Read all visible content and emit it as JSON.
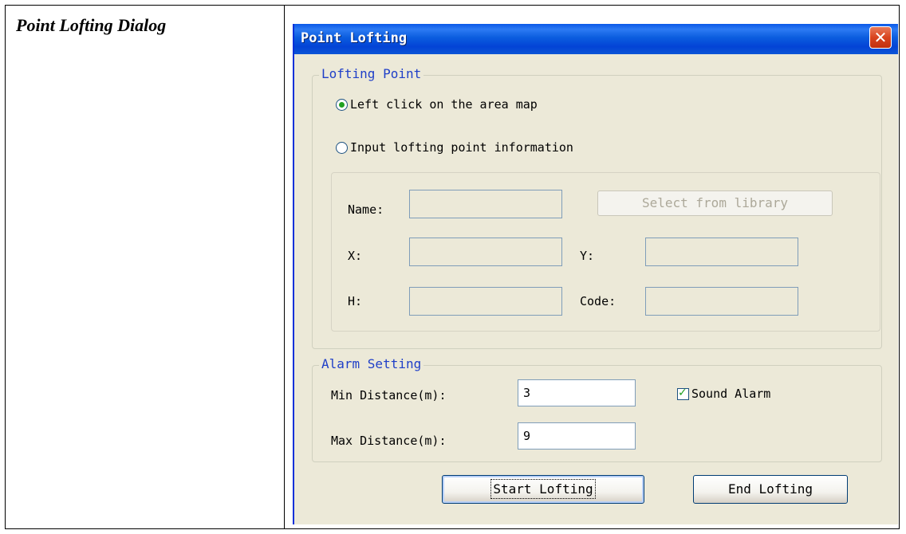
{
  "document": {
    "label": "Point Lofting Dialog"
  },
  "dialog": {
    "title": "Point Lofting",
    "close_symbol": "✕"
  },
  "lofting_point": {
    "group_title": "Lofting Point",
    "option_map": "Left click on the area map",
    "option_input": "Input lofting point information",
    "selected": "option_map",
    "name_label": "Name:",
    "x_label": "X:",
    "y_label": "Y:",
    "h_label": "H:",
    "code_label": "Code:",
    "select_library_label": "Select from library",
    "name_value": "",
    "x_value": "",
    "y_value": "",
    "h_value": "",
    "code_value": ""
  },
  "alarm_setting": {
    "group_title": "Alarm Setting",
    "min_label": "Min Distance(m):",
    "max_label": "Max Distance(m):",
    "min_value": "3",
    "max_value": "9",
    "sound_alarm_label": "Sound Alarm",
    "sound_alarm_checked": true
  },
  "buttons": {
    "start_label": "Start Lofting",
    "end_label": "End Lofting"
  },
  "colors": {
    "titlebar": "#0a58e8",
    "dialog_bg": "#ece9d8",
    "group_title": "#1f3fc8",
    "close_button": "#d9441f",
    "check_green": "#21a121"
  },
  "icons": {
    "close": "close-icon",
    "radio_selected": "radio-selected-icon",
    "radio_unselected": "radio-unselected-icon",
    "checkbox_checked": "checkbox-checked-icon"
  }
}
